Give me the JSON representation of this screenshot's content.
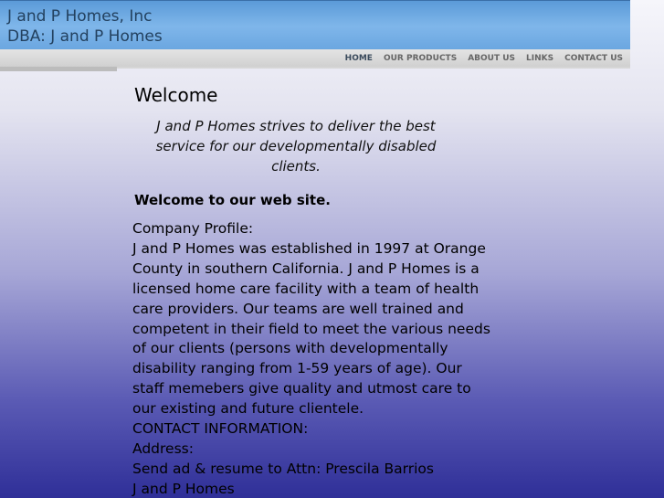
{
  "header": {
    "title_line1": "J and P Homes, Inc",
    "title_line2": "DBA: J and P Homes"
  },
  "nav": {
    "items": [
      {
        "label": "HOME"
      },
      {
        "label": "OUR PRODUCTS"
      },
      {
        "label": "ABOUT US"
      },
      {
        "label": "LINKS"
      },
      {
        "label": "CONTACT US"
      }
    ]
  },
  "main": {
    "heading": "Welcome",
    "tagline": "J and P Homes strives to deliver the best service for our developmentally disabled clients.",
    "subheading": "Welcome to our web site.",
    "profile_title": "Company Profile:",
    "profile_lines": [
      "J and P Homes was established in 1997 at Orange",
      "County in southern California. J and P Homes is a",
      "licensed home care facility with a team of health",
      "care providers. Our teams are well trained and",
      "competent in their field to meet the various needs",
      "of our clients (persons with developmentally",
      "disability ranging from 1-59 years of age). Our",
      "staff memebers give quality and utmost care to",
      "our existing and future clientele."
    ],
    "contact_title": "CONTACT INFORMATION:",
    "address_label": "Address:",
    "address_line1": "Send ad & resume to Attn: Prescila Barrios",
    "address_line2": "J and P Homes"
  }
}
